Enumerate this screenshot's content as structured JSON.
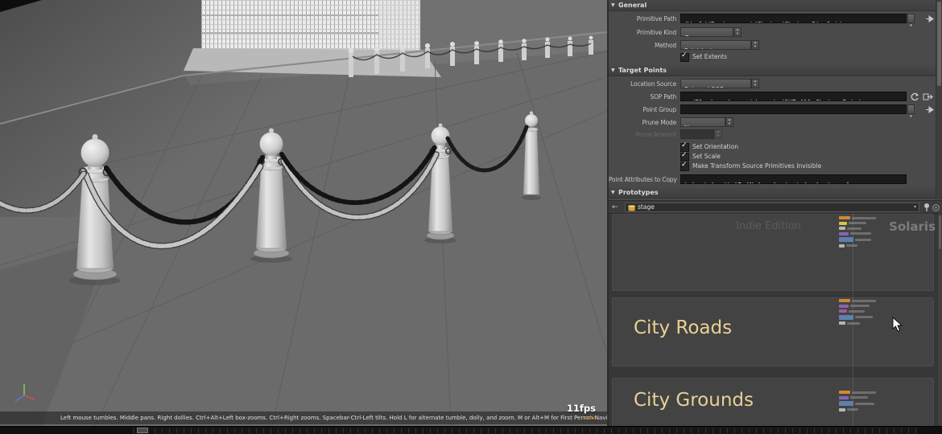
{
  "viewport": {
    "fps": "11fps",
    "watermark": "Indie",
    "help_text": "Left mouse tumbles. Middle pans. Right dollies. Ctrl+Alt+Left box-zooms. Ctrl+Right zooms. Spacebar-Ctrl-Left tilts. Hold L for alternate tumble, dolly, and zoom. M or Alt+M for First Person Navigation."
  },
  "panel": {
    "sections": {
      "general": "General",
      "target_points": "Target Points",
      "prototypes": "Prototypes"
    },
    "primitive_path": {
      "label": "Primitive Path",
      "value": "/World/Environment/Chains/Chains_Simulation"
    },
    "primitive_kind": {
      "label": "Primitive Kind",
      "value": "Group"
    },
    "method": {
      "label": "Method",
      "value": "Point Instancer"
    },
    "set_extents": {
      "label": "Set Extents"
    },
    "location_source": {
      "label": "Location Source",
      "value": "External SOP"
    },
    "sop_path": {
      "label": "SOP Path",
      "value": "../Blockers/sopnet/create/OUT_All_Chains_Points"
    },
    "point_group": {
      "label": "Point Group",
      "value": ""
    },
    "prune_mode": {
      "label": "Prune Mode",
      "value": "None"
    },
    "prune_amount": {
      "label": "Prune Amount"
    },
    "set_orientation": {
      "label": "Set Orientation"
    },
    "set_scale": {
      "label": "Set Scale"
    },
    "make_transform_invisible": {
      "label": "Make Transform Source Primitives Invisible"
    },
    "point_attributes": {
      "label": "Point Attributes to Copy",
      "value": "* ^__* ^usd* ^P ^N ^up ^orient ^v ^w *accel"
    }
  },
  "network": {
    "breadcrumb": "stage",
    "watermark_center": "Indie Edition",
    "watermark_right": "Solaris",
    "backdrops": [
      {
        "label": "City Roads"
      },
      {
        "label": "City Grounds"
      }
    ]
  },
  "icons": {
    "collapse": "▼",
    "spin_up": "▴",
    "spin_down": "▾",
    "chevron_down": "▾",
    "checkmark": "✓",
    "back_arrow": "←"
  },
  "colors": {
    "accent_orange": "#cf8937",
    "backdrop_label": "#e7d195",
    "field_bg": "#1b1b1b",
    "panel_bg": "#4a4a4a"
  }
}
